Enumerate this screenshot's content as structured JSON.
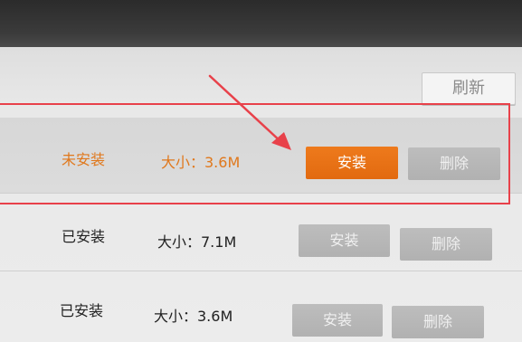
{
  "toolbar": {
    "refresh_label": "刷新"
  },
  "apps": [
    {
      "status": "未安装",
      "size": "大小：3.6M",
      "install_label": "安装",
      "delete_label": "删除"
    },
    {
      "status": "已安装",
      "size": "大小：7.1M",
      "install_label": "安装",
      "delete_label": "删除"
    },
    {
      "status": "已安装",
      "size": "大小：3.6M",
      "install_label": "安装",
      "delete_label": "删除"
    }
  ],
  "colors": {
    "accent": "#e26a10",
    "highlight_box": "#e8414a",
    "disabled_button": "#b7b7b7"
  }
}
